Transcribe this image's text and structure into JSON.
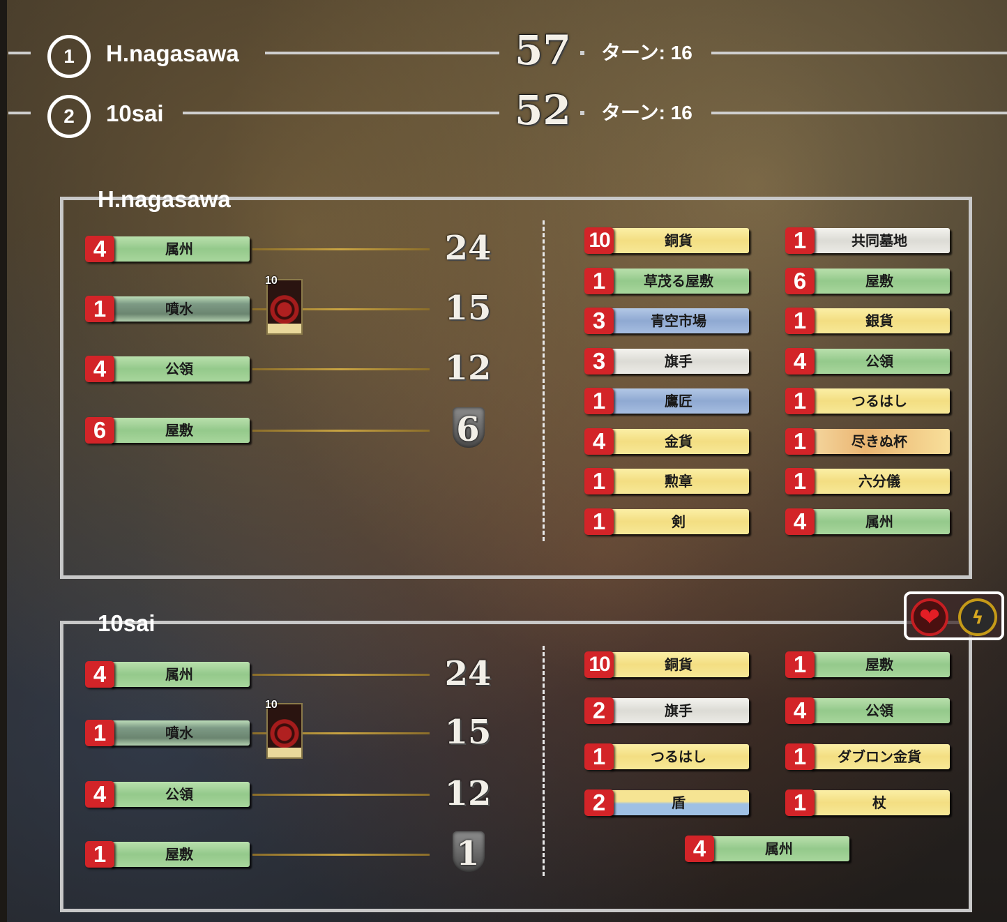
{
  "scoreboard": [
    {
      "rank": "1",
      "name": "H.nagasawa",
      "score": "57",
      "turn_text": "ターン: 16"
    },
    {
      "rank": "2",
      "name": "10sai",
      "score": "52",
      "turn_text": "ターン: 16"
    }
  ],
  "players": [
    {
      "name": "H.nagasawa",
      "vp_cards": [
        {
          "count": "4",
          "name": "属州",
          "color": "green",
          "vp": "24"
        },
        {
          "count": "1",
          "name": "噴水",
          "color": "gray",
          "vp": "15",
          "mini_card_count": "10"
        },
        {
          "count": "4",
          "name": "公領",
          "color": "green",
          "vp": "12"
        },
        {
          "count": "6",
          "name": "屋敷",
          "color": "green",
          "vp": "6"
        }
      ],
      "deck_left": [
        {
          "count": "10",
          "name": "銅貨",
          "color": "yellow"
        },
        {
          "count": "1",
          "name": "草茂る屋敷",
          "color": "green"
        },
        {
          "count": "3",
          "name": "青空市場",
          "color": "blue"
        },
        {
          "count": "3",
          "name": "旗手",
          "color": "white"
        },
        {
          "count": "1",
          "name": "鷹匠",
          "color": "blue"
        },
        {
          "count": "4",
          "name": "金貨",
          "color": "yellow"
        },
        {
          "count": "1",
          "name": "勲章",
          "color": "yellow"
        },
        {
          "count": "1",
          "name": "剣",
          "color": "yellow"
        }
      ],
      "deck_right": [
        {
          "count": "1",
          "name": "共同墓地",
          "color": "white"
        },
        {
          "count": "6",
          "name": "屋敷",
          "color": "green"
        },
        {
          "count": "1",
          "name": "銀貨",
          "color": "yellow"
        },
        {
          "count": "4",
          "name": "公領",
          "color": "green"
        },
        {
          "count": "1",
          "name": "つるはし",
          "color": "yellow"
        },
        {
          "count": "1",
          "name": "尽きぬ杯",
          "color": "cup"
        },
        {
          "count": "1",
          "name": "六分儀",
          "color": "yellow"
        },
        {
          "count": "4",
          "name": "属州",
          "color": "green"
        }
      ]
    },
    {
      "name": "10sai",
      "vp_cards": [
        {
          "count": "4",
          "name": "属州",
          "color": "green",
          "vp": "24"
        },
        {
          "count": "1",
          "name": "噴水",
          "color": "gray",
          "vp": "15",
          "mini_card_count": "10"
        },
        {
          "count": "4",
          "name": "公領",
          "color": "green",
          "vp": "12"
        },
        {
          "count": "1",
          "name": "屋敷",
          "color": "green",
          "vp": "1"
        }
      ],
      "deck_left": [
        {
          "count": "10",
          "name": "銅貨",
          "color": "yellow"
        },
        {
          "count": "2",
          "name": "旗手",
          "color": "white"
        },
        {
          "count": "1",
          "name": "つるはし",
          "color": "yellow"
        },
        {
          "count": "2",
          "name": "盾",
          "color": "shield"
        }
      ],
      "deck_right": [
        {
          "count": "1",
          "name": "屋敷",
          "color": "green"
        },
        {
          "count": "4",
          "name": "公領",
          "color": "green"
        },
        {
          "count": "1",
          "name": "ダブロン金貨",
          "color": "yellow"
        },
        {
          "count": "1",
          "name": "杖",
          "color": "yellow"
        }
      ],
      "last_card": {
        "count": "4",
        "name": "属州",
        "color": "green"
      }
    }
  ],
  "icons": {
    "heart": "heart-icon",
    "bolt": "bolt-icon"
  }
}
